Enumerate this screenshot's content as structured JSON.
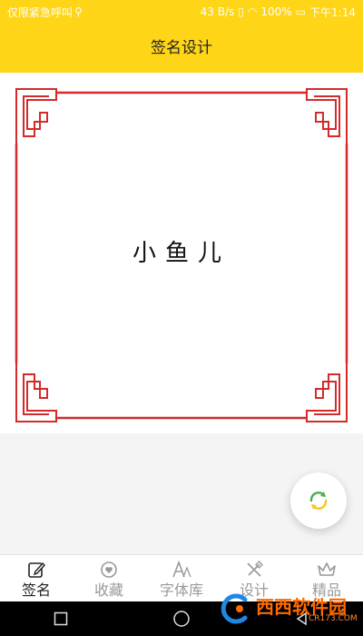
{
  "status_bar": {
    "carrier": "仅限紧急呼叫",
    "speed": "43 B/s",
    "battery": "100%",
    "time": "下午1:14"
  },
  "header": {
    "title": "签名设计"
  },
  "canvas": {
    "signature_text": "小鱼儿"
  },
  "fab": {
    "icon": "refresh-icon",
    "accent_color": "#4caf50",
    "accent_color_2": "#f7c71e"
  },
  "nav": {
    "items": [
      {
        "label": "签名",
        "icon": "pen-icon",
        "active": true
      },
      {
        "label": "收藏",
        "icon": "heart-icon",
        "active": false
      },
      {
        "label": "字体库",
        "icon": "font-icon",
        "active": false
      },
      {
        "label": "设计",
        "icon": "design-icon",
        "active": false
      },
      {
        "label": "精品",
        "icon": "crown-icon",
        "active": false
      }
    ]
  },
  "watermark": {
    "text": "西西软件园",
    "sub": "CR173.COM"
  },
  "colors": {
    "header": "#fed517",
    "frame": "#d42a2a"
  }
}
